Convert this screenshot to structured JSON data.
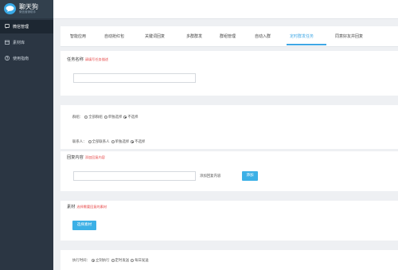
{
  "brand": {
    "title": "聊天狗",
    "subtitle": "微信营销助手"
  },
  "sidebar": {
    "items": [
      {
        "label": "微信管理",
        "icon": "chat-icon",
        "active": true
      },
      {
        "label": "素材库",
        "icon": "folder-icon",
        "active": false
      },
      {
        "label": "使用指南",
        "icon": "help-icon",
        "active": false
      }
    ]
  },
  "tabs": [
    {
      "label": "智能应用",
      "active": false
    },
    {
      "label": "自动抢红包",
      "active": false
    },
    {
      "label": "关键词回复",
      "active": false
    },
    {
      "label": "多群群发",
      "active": false
    },
    {
      "label": "群组管理",
      "active": false
    },
    {
      "label": "自动入群",
      "active": false
    },
    {
      "label": "定时群发任务",
      "active": true
    },
    {
      "label": "同意好友并回复",
      "active": false
    }
  ],
  "form": {
    "task_name": {
      "label": "任务名称",
      "hint": "请填写任务描述"
    },
    "group": {
      "label": "群组：",
      "options": [
        "全部群组",
        "单独选择",
        "不选择"
      ],
      "selected": "不选择"
    },
    "contact": {
      "label": "联系人：",
      "options": [
        "全部联系人",
        "单独选择",
        "不选择"
      ],
      "selected": "不选择"
    },
    "reply": {
      "label": "回复内容",
      "hint": "添加回复内容",
      "side_text": "添加回复内容",
      "add_button": "添加"
    },
    "material": {
      "label": "素材",
      "hint": "选择需要回复的素材",
      "select_button": "选择素材"
    },
    "exec_time": {
      "label": "执行时间：",
      "options": [
        "立刻执行",
        "定时发送",
        "每日发送"
      ],
      "selected": "立刻执行"
    }
  },
  "colors": {
    "accent": "#3fa7e5",
    "sidebar": "#2b3643",
    "hint": "#e64545",
    "button": "#3cb0e6"
  }
}
